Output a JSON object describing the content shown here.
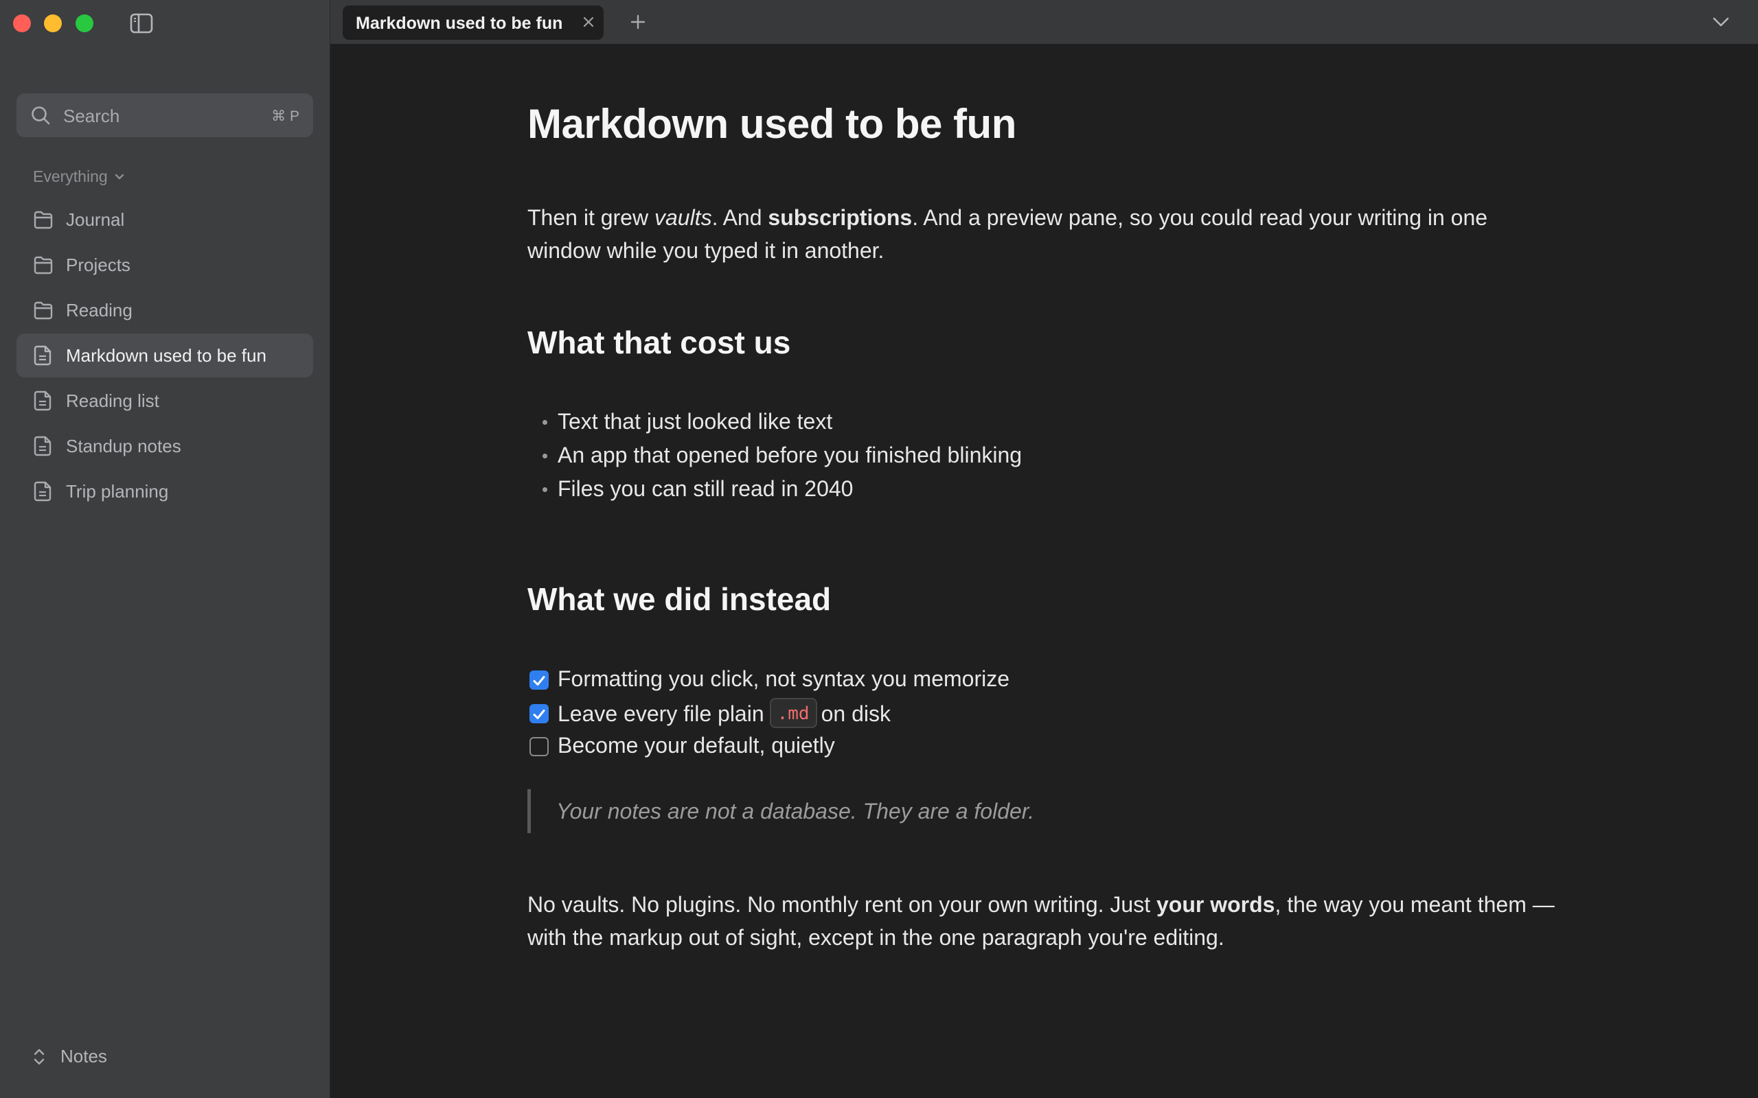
{
  "window": {
    "traffic_lights": [
      "close",
      "minimize",
      "zoom"
    ],
    "colors": {
      "close": "#ff5f57",
      "minimize": "#febc2e",
      "zoom": "#28c840"
    }
  },
  "sidebar": {
    "search": {
      "placeholder": "Search",
      "shortcut": "⌘ P"
    },
    "section": {
      "label": "Everything"
    },
    "items": [
      {
        "label": "Journal",
        "icon": "folder-icon"
      },
      {
        "label": "Projects",
        "icon": "folder-icon"
      },
      {
        "label": "Reading",
        "icon": "folder-icon"
      },
      {
        "label": "Markdown used to be fun",
        "icon": "document-icon",
        "active": true
      },
      {
        "label": "Reading list",
        "icon": "document-icon"
      },
      {
        "label": "Standup notes",
        "icon": "document-icon"
      },
      {
        "label": "Trip planning",
        "icon": "document-icon"
      }
    ],
    "vault": {
      "label": "Notes",
      "icon": "up-down-chevron-icon"
    }
  },
  "tabbar": {
    "tabs": [
      {
        "title": "Markdown used to be fun"
      }
    ]
  },
  "document": {
    "title": "Markdown used to be fun",
    "intro": {
      "t1": "Then it grew ",
      "em1": "vaults",
      "t2": ". And ",
      "strong1": "subscriptions",
      "t3": ". And a preview pane, so you could read your writing in one window while you typed it in another."
    },
    "section1": {
      "heading": "What that cost us",
      "bullets": [
        "Text that just looked like text",
        "An app that opened before you finished blinking",
        "Files you can still read in 2040"
      ]
    },
    "section2": {
      "heading": "What we did instead",
      "tasks": [
        {
          "checked": true,
          "text": "Formatting you click, not syntax you memorize"
        },
        {
          "checked": true,
          "before": "Leave every file plain",
          "code": ".md",
          "after": "on disk"
        },
        {
          "checked": false,
          "text": "Become your default, quietly"
        }
      ]
    },
    "quote": "Your notes are not a database. They are a folder.",
    "closing": {
      "t1": "No vaults. No plugins. No monthly rent on your own writing. Just ",
      "strong1": "your words",
      "t2": ", the way you meant them — with the markup out of sight, except in the one paragraph you're editing."
    },
    "colors": {
      "checkbox_checked": "#2f7ff0",
      "inline_code": "#f26d6d"
    }
  }
}
